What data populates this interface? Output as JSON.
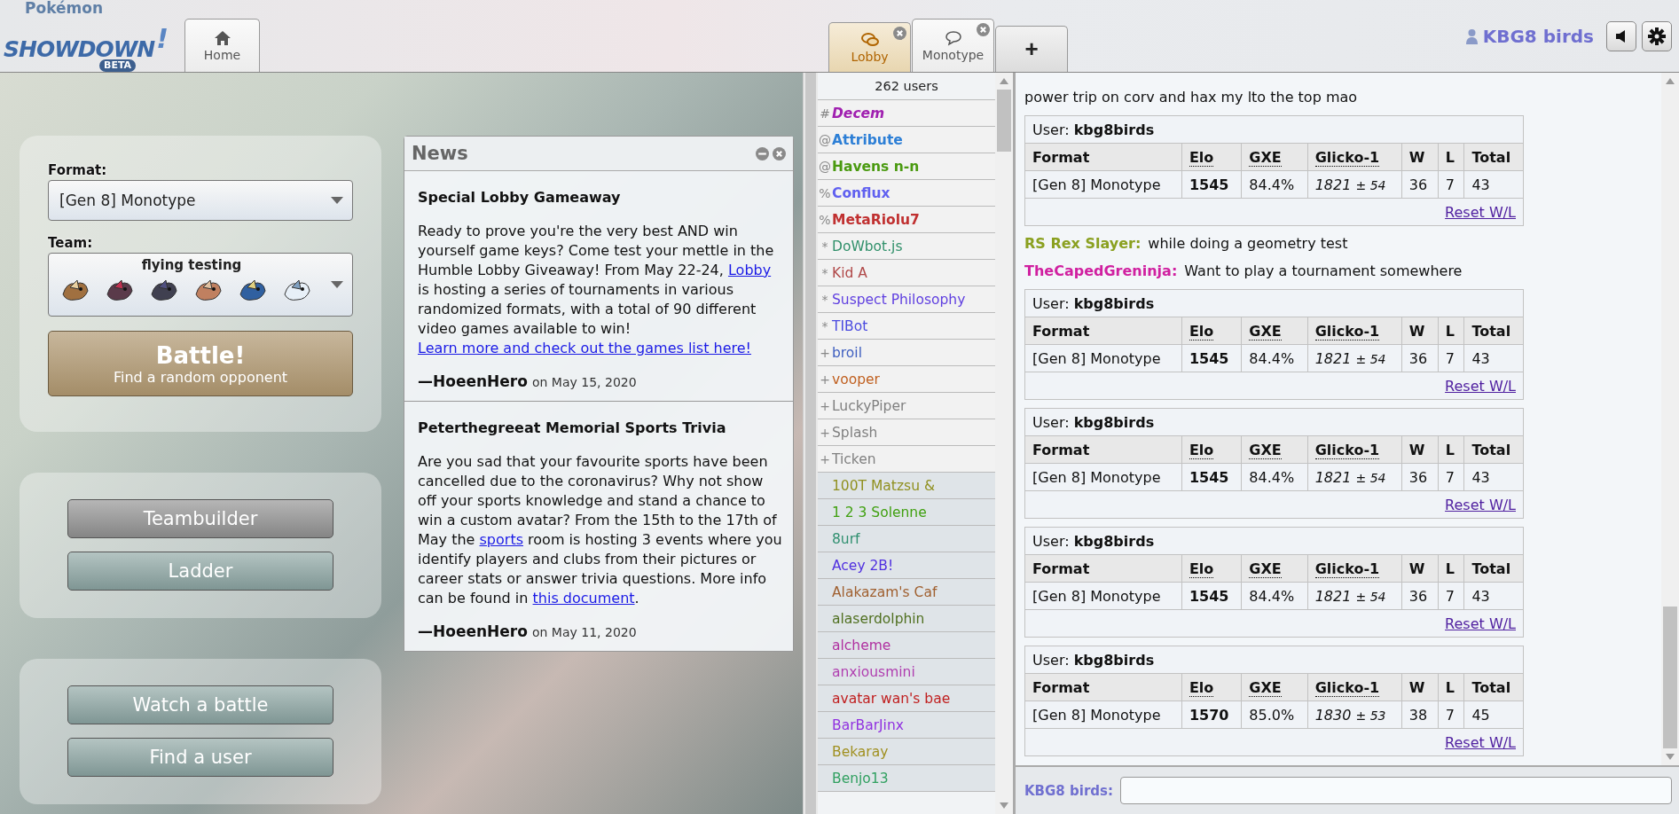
{
  "logo": {
    "title": "Pokémon",
    "wordmark": "SHOWDOWN",
    "exclaim": "!",
    "badge": "BETA"
  },
  "tabs": [
    {
      "kind": "home",
      "label": "Home",
      "selected": true,
      "unread": false,
      "closable": false
    },
    {
      "kind": "lobby",
      "label": "Lobby",
      "selected": false,
      "unread": true,
      "closable": true
    },
    {
      "kind": "room",
      "label": "Monotype",
      "selected": true,
      "unread": false,
      "closable": true
    }
  ],
  "new_tab": {
    "label": "+"
  },
  "user": {
    "name": "KBG8 birds"
  },
  "menu": {
    "format_label": "Format:",
    "format": "[Gen 8] Monotype",
    "team_label": "Team:",
    "team": "flying testing",
    "battle": {
      "label": "Battle!",
      "sub": "Find a random opponent"
    },
    "button_groups": [
      {
        "buttons": [
          "Teambuilder",
          "Ladder"
        ]
      },
      {
        "buttons": [
          "Watch a battle",
          "Find a user"
        ]
      }
    ]
  },
  "news": {
    "title": "News",
    "entries": [
      {
        "title": "Special Lobby Gameaway",
        "body": [
          {
            "kind": "text",
            "text": "Ready to prove you're the very best AND win yourself game keys? Come test your mettle in the Humble Lobby Giveaway! From May 22-24, "
          },
          {
            "kind": "link",
            "text": "Lobby"
          },
          {
            "kind": "text",
            "text": " is hosting a series of tournaments in various randomized formats, with a total of 90 different video games available to win! "
          },
          {
            "kind": "link",
            "text": "Learn more and check out the games list here!"
          }
        ],
        "author": "—HoeenHero",
        "date": "on May 15, 2020"
      },
      {
        "title": "Peterthegreeat Memorial Sports Trivia",
        "body": [
          {
            "kind": "text",
            "text": "Are you sad that your favourite sports have been cancelled due to the coronavirus? Why not show off your sports knowledge and stand a chance to win a custom avatar? From the 15th to the 17th of May the "
          },
          {
            "kind": "link",
            "text": "sports"
          },
          {
            "kind": "text",
            "text": " room is hosting 3 events where you identify players and clubs from their pictures or career stats or answer trivia questions. More info can be found in "
          },
          {
            "kind": "link",
            "text": "this document"
          },
          {
            "kind": "text",
            "text": "."
          }
        ],
        "author": "—HoeenHero",
        "date": "on May 11, 2020"
      }
    ]
  },
  "userlist": {
    "count": "262 users",
    "users": [
      {
        "kind": "owner",
        "rank": "#",
        "name": "Decem",
        "color": "#a020b0"
      },
      {
        "kind": "staff",
        "rank": "@",
        "name": "Attribute",
        "color": "#2d7fd6"
      },
      {
        "kind": "staff",
        "rank": "@",
        "name": "Havens n-n",
        "color": "#4a9a10"
      },
      {
        "kind": "staff",
        "rank": "%",
        "name": "Conflux",
        "color": "#6060f0"
      },
      {
        "kind": "staff",
        "rank": "%",
        "name": "MetaRiolu7",
        "color": "#c03030"
      },
      {
        "kind": "bot",
        "rank": "*",
        "name": "DoWbot.js",
        "color": "#30906a"
      },
      {
        "kind": "bot",
        "rank": "*",
        "name": "Kid A",
        "color": "#b04848"
      },
      {
        "kind": "bot",
        "rank": "*",
        "name": "Suspect Philosophy",
        "color": "#6040e0"
      },
      {
        "kind": "bot",
        "rank": "*",
        "name": "TIBot",
        "color": "#4a4ae0"
      },
      {
        "kind": "voice",
        "rank": "+",
        "name": "broil",
        "color": "#4060c0"
      },
      {
        "kind": "voice",
        "rank": "+",
        "name": "vooper",
        "color": "#c06020"
      },
      {
        "kind": "voice",
        "rank": "+",
        "name": "LuckyPiper",
        "color": "#808080"
      },
      {
        "kind": "voice",
        "rank": "+",
        "name": "Splash",
        "color": "#808080"
      },
      {
        "kind": "voice",
        "rank": "+",
        "name": "Ticken",
        "color": "#808080"
      },
      {
        "kind": "user",
        "name": "100T Matzsu &",
        "color": "#909020"
      },
      {
        "kind": "user",
        "name": "1 2 3 Solenne",
        "color": "#40a010"
      },
      {
        "kind": "user",
        "name": "8urf",
        "color": "#309070"
      },
      {
        "kind": "user",
        "name": "Acey 2B!",
        "color": "#5030e0"
      },
      {
        "kind": "user",
        "name": "Alakazam's Caf",
        "color": "#a06030"
      },
      {
        "kind": "user",
        "name": "alaserdolphin",
        "color": "#507020"
      },
      {
        "kind": "user",
        "name": "alcheme",
        "color": "#b030a0"
      },
      {
        "kind": "user",
        "name": "anxiousmini",
        "color": "#b040b0"
      },
      {
        "kind": "user",
        "name": "avatar wan's bae",
        "color": "#c02020"
      },
      {
        "kind": "user",
        "name": "BarBarJinx",
        "color": "#9030e0"
      },
      {
        "kind": "user",
        "name": "Bekaray",
        "color": "#a09020"
      },
      {
        "kind": "user",
        "name": "Benjo13",
        "color": "#30a060"
      }
    ]
  },
  "chat": {
    "log": [
      {
        "kind": "text",
        "text": "power trip on corv and hax my lto the top mao"
      },
      {
        "kind": "ladder",
        "user": "User: **kbg8birds**",
        "format": "[Gen 8] Monotype",
        "elo": "1545",
        "gxe": "84.4%",
        "glicko": "1821",
        "deviation": "± 54",
        "w": "36",
        "l": "7",
        "total": "43",
        "reset": "Reset W/L",
        "columns": [
          {
            "label": "Format",
            "abbr": false
          },
          {
            "label": "Elo",
            "abbr": true
          },
          {
            "label": "GXE",
            "abbr": true
          },
          {
            "label": "Glicko-1",
            "abbr": true
          },
          {
            "label": "W",
            "abbr": false
          },
          {
            "label": "L",
            "abbr": false
          },
          {
            "label": "Total",
            "abbr": false
          }
        ]
      },
      {
        "kind": "message",
        "name": "RS Rex Slayer:",
        "color": "#8aa020",
        "text": "while doing a geometry test"
      },
      {
        "kind": "message",
        "name": "TheCapedGreninja:",
        "color": "#d020a0",
        "text": "Want to play a tournament somewhere"
      },
      {
        "kind": "ladder",
        "user": "User: **kbg8birds**",
        "format": "[Gen 8] Monotype",
        "elo": "1545",
        "gxe": "84.4%",
        "glicko": "1821",
        "deviation": "± 54",
        "w": "36",
        "l": "7",
        "total": "43",
        "reset": "Reset W/L",
        "columns": [
          {
            "label": "Format",
            "abbr": false
          },
          {
            "label": "Elo",
            "abbr": true
          },
          {
            "label": "GXE",
            "abbr": true
          },
          {
            "label": "Glicko-1",
            "abbr": true
          },
          {
            "label": "W",
            "abbr": false
          },
          {
            "label": "L",
            "abbr": false
          },
          {
            "label": "Total",
            "abbr": false
          }
        ]
      },
      {
        "kind": "ladder",
        "user": "User: **kbg8birds**",
        "format": "[Gen 8] Monotype",
        "elo": "1545",
        "gxe": "84.4%",
        "glicko": "1821",
        "deviation": "± 54",
        "w": "36",
        "l": "7",
        "total": "43",
        "reset": "Reset W/L",
        "columns": [
          {
            "label": "Format",
            "abbr": false
          },
          {
            "label": "Elo",
            "abbr": true
          },
          {
            "label": "GXE",
            "abbr": true
          },
          {
            "label": "Glicko-1",
            "abbr": true
          },
          {
            "label": "W",
            "abbr": false
          },
          {
            "label": "L",
            "abbr": false
          },
          {
            "label": "Total",
            "abbr": false
          }
        ]
      },
      {
        "kind": "ladder",
        "user": "User: **kbg8birds**",
        "format": "[Gen 8] Monotype",
        "elo": "1545",
        "gxe": "84.4%",
        "glicko": "1821",
        "deviation": "± 54",
        "w": "36",
        "l": "7",
        "total": "43",
        "reset": "Reset W/L",
        "columns": [
          {
            "label": "Format",
            "abbr": false
          },
          {
            "label": "Elo",
            "abbr": true
          },
          {
            "label": "GXE",
            "abbr": true
          },
          {
            "label": "Glicko-1",
            "abbr": true
          },
          {
            "label": "W",
            "abbr": false
          },
          {
            "label": "L",
            "abbr": false
          },
          {
            "label": "Total",
            "abbr": false
          }
        ]
      },
      {
        "kind": "ladder",
        "user": "User: **kbg8birds**",
        "format": "[Gen 8] Monotype",
        "elo": "1570",
        "gxe": "85.0%",
        "glicko": "1830",
        "deviation": "± 53",
        "w": "38",
        "l": "7",
        "total": "45",
        "reset": "Reset W/L",
        "columns": [
          {
            "label": "Format",
            "abbr": false
          },
          {
            "label": "Elo",
            "abbr": true
          },
          {
            "label": "GXE",
            "abbr": true
          },
          {
            "label": "Glicko-1",
            "abbr": true
          },
          {
            "label": "W",
            "abbr": false
          },
          {
            "label": "L",
            "abbr": false
          },
          {
            "label": "Total",
            "abbr": false
          }
        ]
      }
    ],
    "input_label": "KBG8 birds:"
  }
}
